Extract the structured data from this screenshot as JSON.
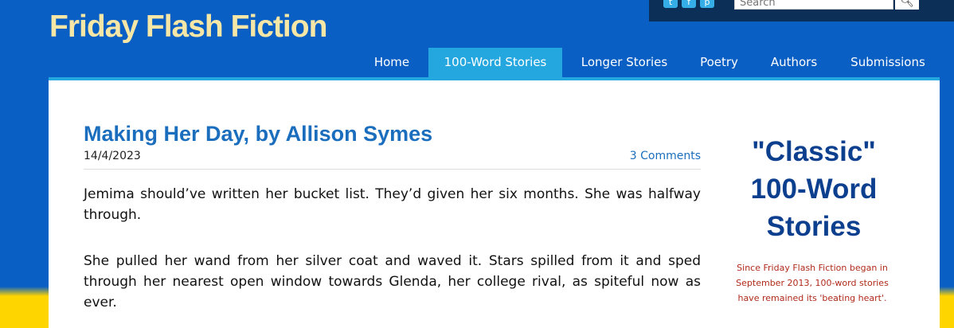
{
  "site": {
    "title": "Friday Flash Fiction"
  },
  "search": {
    "placeholder": "Search"
  },
  "nav": {
    "home": "Home",
    "hundred": "100-Word Stories",
    "longer": "Longer Stories",
    "poetry": "Poetry",
    "authors": "Authors",
    "submissions": "Submissions",
    "active": "100-Word Stories"
  },
  "post": {
    "title": "Making Her Day, by Allison Symes",
    "date": "14/4/2023",
    "comments": "3 Comments",
    "paragraphs": [
      "Jemima should’ve written her bucket list. They’d given her six months. She was halfway through.",
      "She pulled her wand from her silver coat and waved it. Stars spilled from it and sped through her nearest open window towards Glenda, her college rival, as spiteful now as ever."
    ]
  },
  "sidebar": {
    "title_line1": "\"Classic\"",
    "title_line2": "100-Word",
    "title_line3": "Stories",
    "text": "Since Friday Flash Fiction began in September 2013, 100-word stories have remained its 'beating heart'."
  },
  "colors": {
    "background": "#0a5fc4",
    "footer_stripe": "#ffd500",
    "title": "#f7e7a6",
    "nav_active": "#24a6df",
    "link": "#1b6ebd",
    "sidebar_title": "#0d3f8f",
    "sidebar_text": "#b02a1a"
  },
  "icons": [
    "twitter-icon",
    "facebook-icon",
    "pinterest-icon",
    "search-icon"
  ]
}
